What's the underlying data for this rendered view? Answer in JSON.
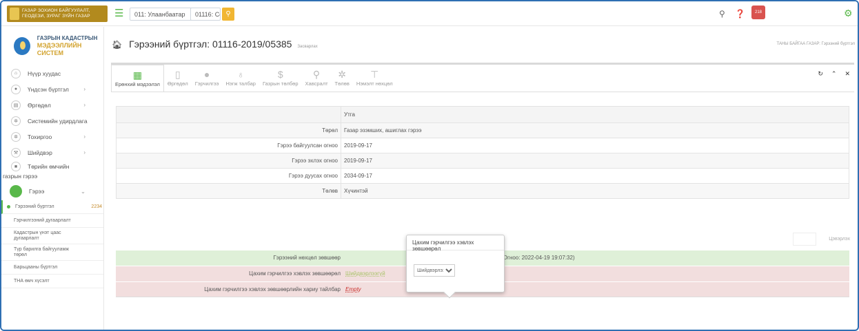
{
  "topbar": {
    "logo_text_line1": "ГАЗАР ЗОХИОН БАЙГУУЛАЛТ,",
    "logo_text_line2": "ГЕОДЕЗИ, ЗУРАГ ЗҮЙН ГАЗАР",
    "province_select": "011: Улаанбаатар",
    "district_select": "01116: Сонгинохайрхан",
    "notification_count": "218"
  },
  "brand": {
    "line1": "ГАЗРЫН КАДАСТРЫН",
    "line2": "МЭДЭЭЛЛИЙН СИСТЕМ"
  },
  "sidebar": {
    "items": [
      {
        "label": "Нүүр хуудас",
        "icon": "home-icon",
        "chevron": ""
      },
      {
        "label": "Үндсэн бүртгэл",
        "icon": "user-icon",
        "chevron": "›"
      },
      {
        "label": "Өргөдөл",
        "icon": "document-icon",
        "chevron": "›"
      },
      {
        "label": "Системийн удирдлага",
        "icon": "cogs-icon",
        "chevron": ""
      },
      {
        "label": "Тохиргоо",
        "icon": "cogs-icon",
        "chevron": "›"
      },
      {
        "label": "Шийдвэр",
        "icon": "gavel-icon",
        "chevron": "›"
      }
    ],
    "special_line1": "Төрийн өмчийн",
    "special_line2": "газрын гэрээ",
    "active_label": "Гэрээ",
    "active_chevron": "⌄",
    "sub_items": [
      {
        "label": "Гэрээний бүртгэл",
        "count": "2234"
      },
      {
        "label": "Гэрчилгээний дугаарлалт",
        "count": ""
      },
      {
        "label_line1": "Кадастрын үнэт цаас",
        "label_line2": "дугаарлалт"
      },
      {
        "label_line1": "Түр барилга байгууламж",
        "label_line2": "төрөл"
      },
      {
        "label": "Барьцааны бүртгэл",
        "count": ""
      },
      {
        "label": "ТНА өмч хүсэлт",
        "count": ""
      }
    ]
  },
  "page": {
    "title": "Гэрээний бүртгэл: 01116-2019/05385",
    "title_suffix": "Засварлах",
    "breadcrumb": "ТАНЫ БАЙГАА ГАЗАР:  Гэрээний бүртгэл"
  },
  "tabs": [
    {
      "label": "Ерөнхий мэдээлэл",
      "icon": "table-icon"
    },
    {
      "label": "Өргөдөл",
      "icon": "file-icon"
    },
    {
      "label": "Гэрчилгээ",
      "icon": "circle-icon"
    },
    {
      "label": "Нэгж талбар",
      "icon": "map-marker-icon"
    },
    {
      "label": "Газрын төлбөр",
      "icon": "dollar-icon"
    },
    {
      "label": "Хавсралт",
      "icon": "paperclip-icon"
    },
    {
      "label": "Төлөв",
      "icon": "cogs-icon"
    },
    {
      "label": "Нэмэлт нөхцөл",
      "icon": "sitemap-icon"
    }
  ],
  "table": {
    "header_value": "Утга",
    "rows": [
      {
        "label": "Төрөл",
        "value": "Газар эзэмших, ашиглах гэрээ"
      },
      {
        "label": "Гэрээ байгуулсан огноо",
        "value": "2019-09-17"
      },
      {
        "label": "Гэрээ эхлэх огноо",
        "value": "2019-09-17"
      },
      {
        "label": "Гэрээ дуусах огноо",
        "value": "2034-09-17"
      },
      {
        "label": "Төлөв",
        "value": "Хүчинтэй"
      }
    ]
  },
  "search_label": "Цэвэрлэх",
  "green_row": {
    "label": "Гэрээний нөхцөл зөвшөөр",
    "value": "ашиглагч: Баянмөнх Мөнхцэцэг Огноо: 2022-04-19 19:07:32)"
  },
  "pink_rows": [
    {
      "label": "Цахим гэрчилгээ хэвлэх зөвшөөрөл",
      "value": "Шийдвэрлээгүй"
    },
    {
      "label": "Цахим гэрчилгээ хэвлэх зөвшөөрлийн хариу тайлбар",
      "value": "Empty"
    }
  ],
  "popover": {
    "title": "Цахим гэрчилгээ хэвлэх зөвшөөрөл",
    "selected": "Шийдвэрлээгүй"
  },
  "colors": {
    "accent": "#59b84a",
    "frame": "#2f6fb3",
    "green_row": "#dff0d8",
    "pink_row": "#f2dede"
  }
}
